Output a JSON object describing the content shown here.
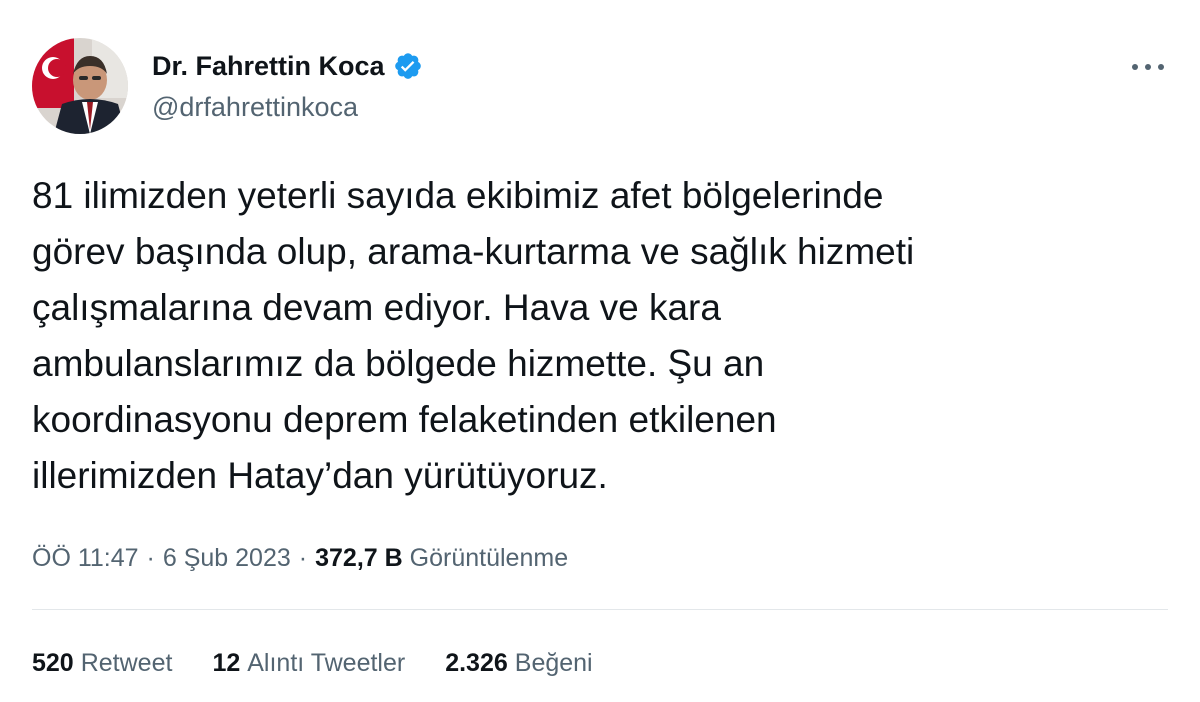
{
  "author": {
    "display_name": "Dr. Fahrettin Koca",
    "handle": "@drfahrettinkoca",
    "verified": true
  },
  "tweet": {
    "text": "81 ilimizden yeterli sayıda ekibimiz afet bölgelerinde\ngörev başında olup, arama-kurtarma ve sağlık hizmeti\nçalışmalarına devam ediyor. Hava ve kara\nambulanslarımız da bölgede hizmette. Şu an\nkoordinasyonu deprem felaketinden etkilenen\nillerimizden Hatay’dan yürütüyoruz."
  },
  "meta": {
    "time": "ÖÖ 11:47",
    "separator": "·",
    "date": "6 Şub 2023",
    "views_count": "372,7 B",
    "views_label": "Görüntülenme"
  },
  "stats": {
    "retweets": {
      "count": "520",
      "label": "Retweet"
    },
    "quotes": {
      "count": "12",
      "label": "Alıntı Tweetler"
    },
    "likes": {
      "count": "2.326",
      "label": "Beğeni"
    }
  },
  "icons": {
    "verified": "verified-badge-icon",
    "more": "more-horizontal-icon"
  },
  "colors": {
    "text": "#0f1419",
    "secondary": "#536471",
    "verified": "#1d9bf0",
    "divider": "#e3e7ea"
  }
}
